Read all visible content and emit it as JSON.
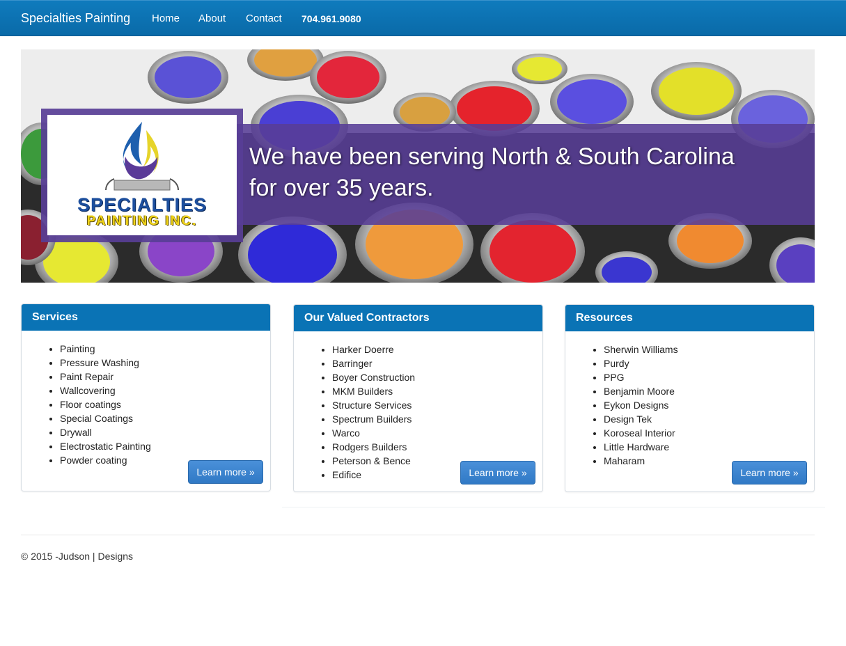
{
  "navbar": {
    "brand": "Specialties Painting",
    "links": [
      {
        "label": "Home"
      },
      {
        "label": "About"
      },
      {
        "label": "Contact"
      },
      {
        "label": "704.961.9080"
      }
    ]
  },
  "hero": {
    "tagline_line1": "We have been serving North & South Carolina",
    "tagline_line2": "for over 35 years.",
    "logo_text_line1": "SPECIALTIES",
    "logo_text_line2": "PAINTING INC."
  },
  "panels": [
    {
      "title": "Services",
      "items": [
        "Painting",
        "Pressure Washing",
        "Paint Repair",
        "Wallcovering",
        "Floor coatings",
        "Special Coatings",
        "Drywall",
        "Electrostatic Painting",
        "Powder coating"
      ],
      "button": "Learn more »"
    },
    {
      "title": "Our Valued Contractors",
      "items": [
        "Harker Doerre",
        "Barringer",
        "Boyer Construction",
        "MKM Builders",
        "Structure Services",
        "Spectrum Builders",
        "Warco",
        "Rodgers Builders",
        "Peterson & Bence",
        "Edifice"
      ],
      "button": "Learn more »"
    },
    {
      "title": "Resources",
      "items": [
        "Sherwin Williams",
        "Purdy",
        "PPG",
        "Benjamin Moore",
        "Eykon Designs",
        "Design Tek",
        "Koroseal Interior",
        "Little Hardware",
        "Maharam"
      ],
      "button": "Learn more »"
    }
  ],
  "footer": {
    "text": "© 2015 -Judson | Designs"
  },
  "colors": {
    "navbar": "#0a6aa8",
    "panel_heading": "#0a73b5",
    "button": "#3a85cf",
    "banner_purple": "#583e96"
  }
}
